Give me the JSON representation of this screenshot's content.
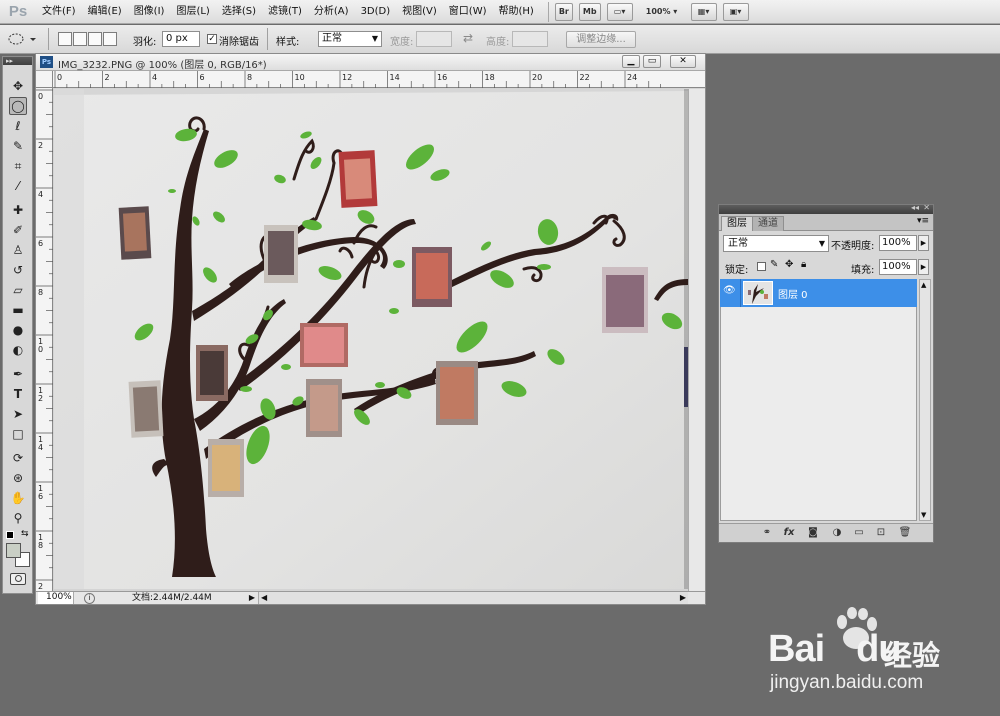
{
  "menubar": {
    "logo": "Ps",
    "items": [
      "文件(F)",
      "编辑(E)",
      "图像(I)",
      "图层(L)",
      "选择(S)",
      "滤镜(T)",
      "分析(A)",
      "3D(D)",
      "视图(V)",
      "窗口(W)",
      "帮助(H)"
    ],
    "bridge_btn": "Br",
    "minibridge_btn": "Mb",
    "zoom": "100%"
  },
  "options": {
    "feather_label": "羽化:",
    "feather_value": "0 px",
    "antialias_label": "消除锯齿",
    "style_label": "样式:",
    "style_value": "正常",
    "width_label": "宽度:",
    "height_label": "高度:",
    "refine_edge_label": "调整边缘..."
  },
  "document": {
    "title": "IMG_3232.PNG @ 100% (图层 0, RGB/16*)",
    "ruler_top_labels": [
      "0",
      "2",
      "4",
      "6",
      "8",
      "10",
      "12",
      "14",
      "16",
      "18",
      "20",
      "22",
      "24"
    ],
    "ruler_left_labels": [
      "0",
      "2",
      "4",
      "6",
      "8",
      "1\n0",
      "1\n2",
      "1\n4",
      "1\n6",
      "1\n8",
      "2"
    ],
    "status_zoom": "100%",
    "status_doc": "文档:2.44M/2.44M"
  },
  "layers_panel": {
    "tab_layers": "图层",
    "tab_channels": "通道",
    "blend_mode": "正常",
    "opacity_label": "不透明度:",
    "opacity_value": "100%",
    "lock_label": "锁定:",
    "fill_label": "填充:",
    "fill_value": "100%",
    "layer_name": "图层 0"
  },
  "watermark": {
    "brand_a": "Bai",
    "brand_b": "du",
    "brand_cn": "经验",
    "url": "jingyan.baidu.com"
  },
  "colors": {
    "selection_blue": "#3d8fe8",
    "leaf_green": "#5cb33a",
    "trunk_brown": "#2f1d1a",
    "wall": "#e4e4e4"
  }
}
